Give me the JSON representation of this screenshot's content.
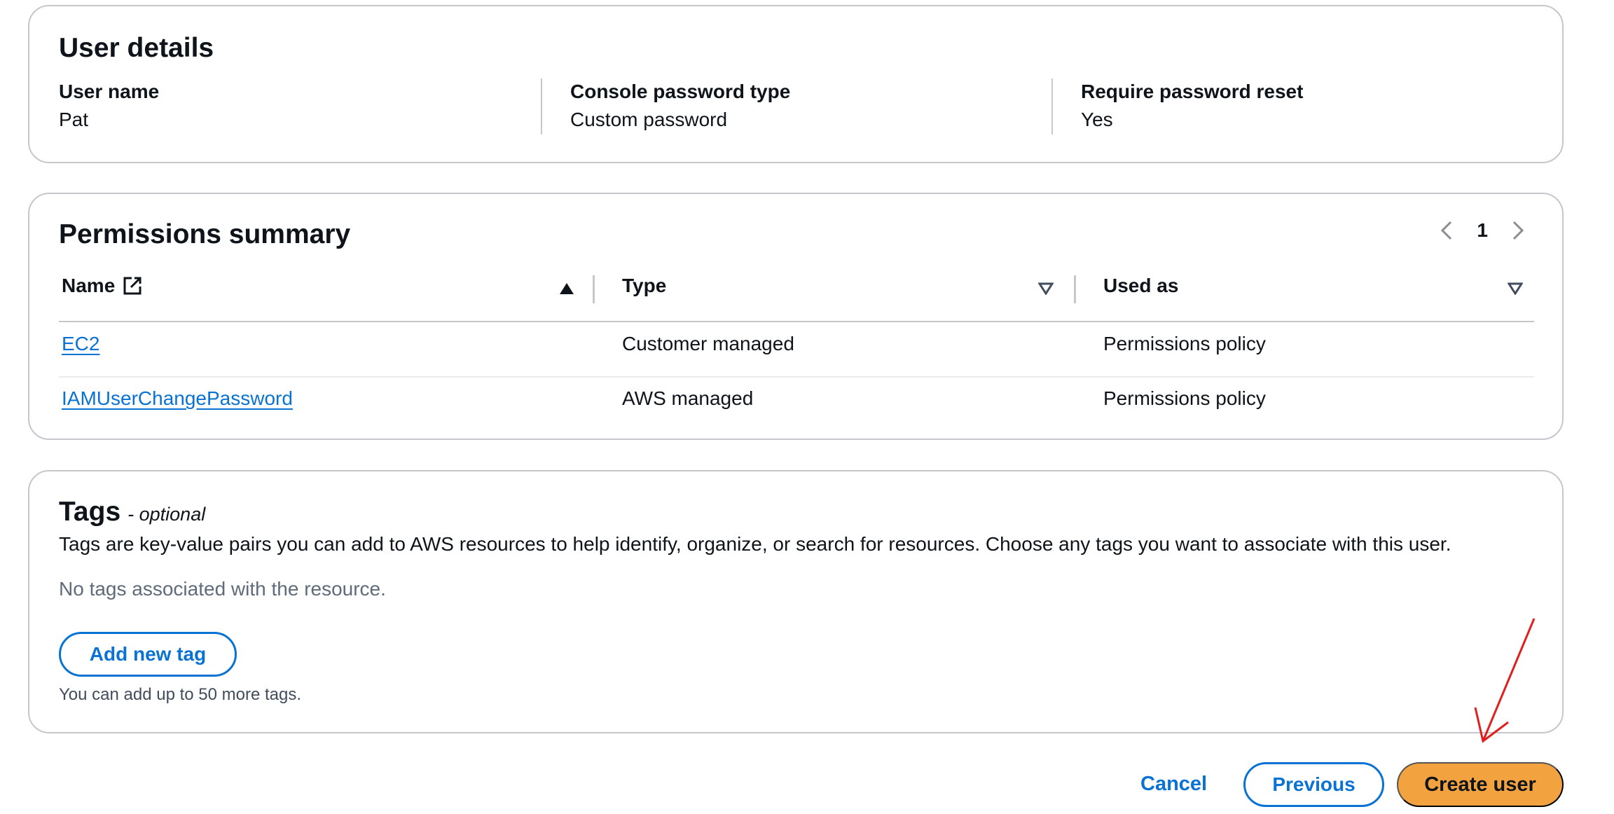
{
  "user_details": {
    "title": "User details",
    "fields": [
      {
        "label": "User name",
        "value": "Pat"
      },
      {
        "label": "Console password type",
        "value": "Custom password"
      },
      {
        "label": "Require password reset",
        "value": "Yes"
      }
    ]
  },
  "permissions": {
    "title": "Permissions summary",
    "page": "1",
    "columns": [
      "Name",
      "Type",
      "Used as"
    ],
    "rows": [
      {
        "name": "EC2",
        "type": "Customer managed",
        "used_as": "Permissions policy"
      },
      {
        "name": "IAMUserChangePassword",
        "type": "AWS managed",
        "used_as": "Permissions policy"
      }
    ]
  },
  "tags": {
    "title": "Tags",
    "optional": "- optional",
    "description": "Tags are key-value pairs you can add to AWS resources to help identify, organize, or search for resources. Choose any tags you want to associate with this user.",
    "empty": "No tags associated with the resource.",
    "add_button": "Add new tag",
    "limit": "You can add up to 50 more tags."
  },
  "footer": {
    "cancel": "Cancel",
    "previous": "Previous",
    "create": "Create user"
  },
  "colors": {
    "link": "#0972d3",
    "primary_button": "#f2a33f",
    "border": "#c6c6cd",
    "annotation_arrow": "#e0201d"
  },
  "icons": [
    "external-link-icon",
    "sort-ascending-icon",
    "sort-descending-icon",
    "chevron-left-icon",
    "chevron-right-icon"
  ]
}
